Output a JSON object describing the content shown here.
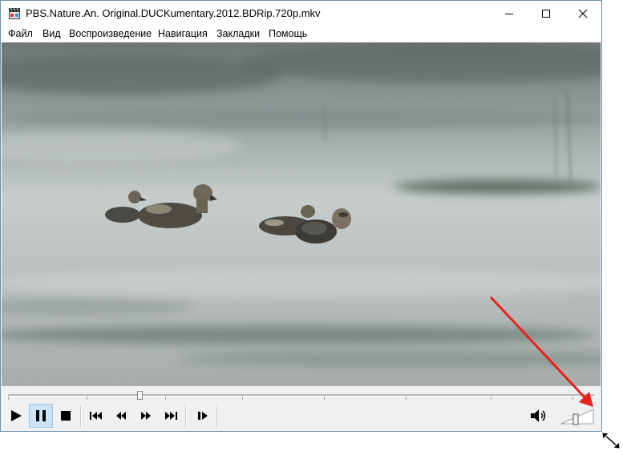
{
  "window": {
    "title": "PBS.Nature.An. Original.DUCKumentary.2012.BDRip.720p.mkv",
    "app_icon": "film-clapper-icon",
    "controls": [
      "minimize-icon",
      "maximize-icon",
      "close-icon"
    ]
  },
  "menu": {
    "items": [
      {
        "label": "Файл"
      },
      {
        "label": "Вид"
      },
      {
        "label": "Воспроизведение"
      },
      {
        "label": "Навигация"
      },
      {
        "label": "Закладки"
      },
      {
        "label": "Помощь"
      }
    ]
  },
  "video": {
    "description_icon": "video-frame"
  },
  "seekbar": {
    "position_fraction": 0.22
  },
  "toolbar": {
    "buttons": [
      {
        "name": "play",
        "icon": "play-icon",
        "active": false
      },
      {
        "name": "pause",
        "icon": "pause-icon",
        "active": true
      },
      {
        "name": "stop",
        "icon": "stop-icon",
        "active": false
      },
      {
        "name": "previous",
        "icon": "skip-back-icon",
        "active": false
      },
      {
        "name": "rewind",
        "icon": "rewind-icon",
        "active": false
      },
      {
        "name": "fast-forward",
        "icon": "fast-forward-icon",
        "active": false
      },
      {
        "name": "next",
        "icon": "skip-forward-icon",
        "active": false
      },
      {
        "name": "frame-step",
        "icon": "frame-step-icon",
        "active": false
      }
    ],
    "volume_icon": "speaker-icon",
    "volume_fraction": 0.45
  },
  "annotation": {
    "arrow_color": "#e8231c"
  }
}
